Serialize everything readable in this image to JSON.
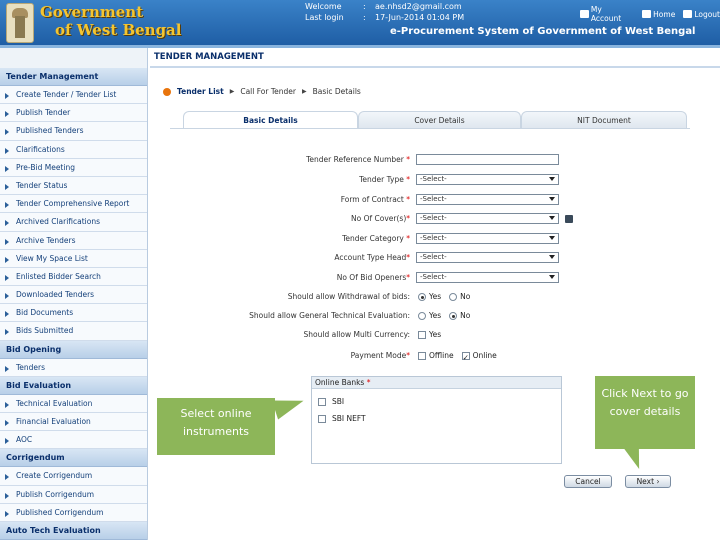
{
  "header": {
    "gov_line1": "Government",
    "gov_line2": "of West Bengal",
    "welcome_label": "Welcome",
    "welcome_value": "ae.nhsd2@gmail.com",
    "lastlogin_label": "Last login",
    "lastlogin_value": "17-Jun-2014 01:04 PM",
    "colon": ":",
    "links": [
      "My Account",
      "Home",
      "Logout"
    ],
    "system_title": "e-Procurement System of Government of West Bengal"
  },
  "sidebar": {
    "sections": [
      {
        "title": "Tender Management",
        "items": [
          "Create Tender / Tender List",
          "Publish Tender",
          "Published Tenders",
          "Clarifications",
          "Pre-Bid Meeting",
          "Tender Status",
          "Tender Comprehensive Report",
          "Archived Clarifications",
          "Archive Tenders",
          "View My Space List",
          "Enlisted Bidder Search",
          "Downloaded Tenders",
          "Bid Documents",
          "Bids Submitted"
        ]
      },
      {
        "title": "Bid Opening",
        "items": [
          "Tenders"
        ]
      },
      {
        "title": "Bid Evaluation",
        "items": [
          "Technical Evaluation",
          "Financial Evaluation",
          "AOC"
        ]
      },
      {
        "title": "Corrigendum",
        "items": [
          "Create Corrigendum",
          "Publish Corrigendum",
          "Published Corrigendum"
        ]
      },
      {
        "title": "Auto Tech Evaluation",
        "items": []
      }
    ]
  },
  "page_title": "TENDER MANAGEMENT",
  "breadcrumb": {
    "first": "Tender List",
    "second": "Call For Tender",
    "third": "Basic Details"
  },
  "tabs": [
    "Basic Details",
    "Cover Details",
    "NIT Document"
  ],
  "form": {
    "tender_ref_label": "Tender Reference Number",
    "tender_ref_value": "",
    "tender_type_label": "Tender Type",
    "tender_type_value": "-Select-",
    "form_contract_label": "Form of Contract",
    "form_contract_value": "-Select-",
    "no_covers_label": "No Of Cover(s)",
    "no_covers_value": "-Select-",
    "category_label": "Tender Category",
    "category_value": "-Select-",
    "account_head_label": "Account Type Head",
    "account_head_value": "-Select-",
    "bid_openers_label": "No Of Bid Openers",
    "bid_openers_value": "-Select-",
    "withdrawal_label": "Should allow Withdrawal of bids:",
    "general_tech_label": "Should allow General Technical Evaluation:",
    "multi_currency_label": "Should allow Multi Currency:",
    "payment_mode_label": "Payment Mode",
    "yes": "Yes",
    "no": "No",
    "offline": "Offline",
    "online": "Online",
    "req": "*"
  },
  "banks": {
    "header": "Online Banks",
    "items": [
      "SBI",
      "SBI NEFT"
    ]
  },
  "callouts": {
    "left": "Select online instruments",
    "right": "Click Next to go cover details"
  },
  "buttons": {
    "cancel": "Cancel",
    "next": "Next"
  }
}
